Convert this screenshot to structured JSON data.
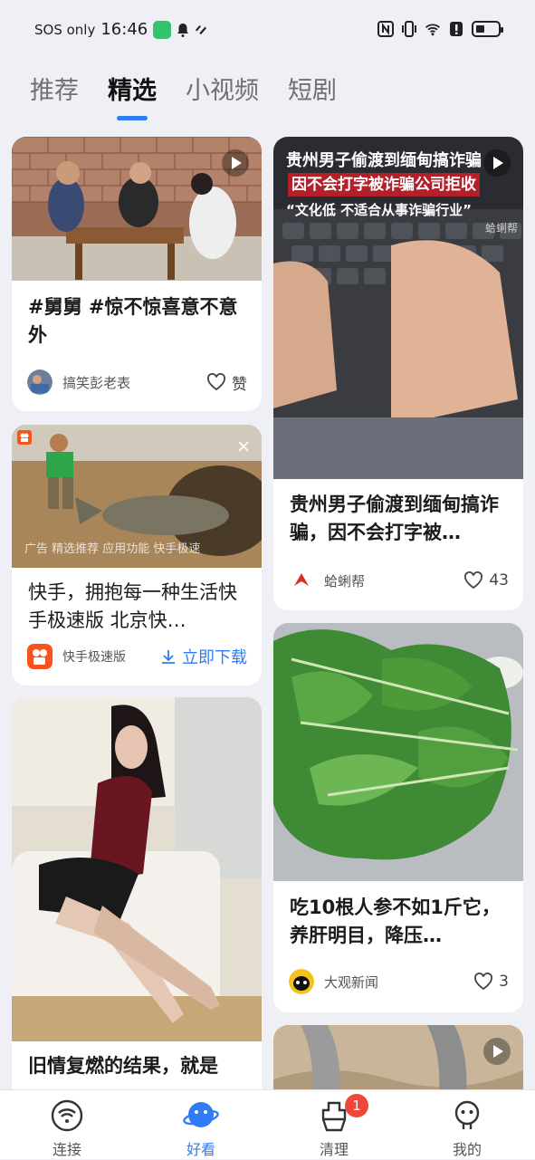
{
  "status_bar": {
    "carrier": "SOS only",
    "time": "16:46"
  },
  "tabs": [
    "推荐",
    "精选",
    "小视频",
    "短剧"
  ],
  "active_tab": "精选",
  "feed": {
    "left": [
      {
        "title": "#舅舅 #惊不惊喜意不意外",
        "author": "搞笑彭老表",
        "action": "赞"
      },
      {
        "title": "快手，拥抱每一种生活快手极速版 北京快…",
        "author": "快手极速版",
        "action": "立即下载",
        "overlay_text": "广告 精选推荐 应用功能 快手极速"
      },
      {
        "title": "旧情复燃的结果，就是"
      }
    ],
    "right": [
      {
        "title": "贵州男子偷渡到缅甸搞诈骗，因不会打字被…",
        "author": "蛤蜊帮",
        "likes": "43",
        "overlay": {
          "line1": "贵州男子偷渡到缅甸搞诈骗",
          "line2": "因不会打字被诈骗公司拒收",
          "line3": "“文化低 不适合从事诈骗行业”",
          "watermark": "蛤蜊帮"
        }
      },
      {
        "title": "吃10根人参不如1斤它，养肝明目，降压…",
        "author": "大观新闻",
        "likes": "3"
      }
    ]
  },
  "bottom_nav": [
    {
      "label": "连接",
      "icon": "wifi-icon"
    },
    {
      "label": "好看",
      "icon": "planet-icon"
    },
    {
      "label": "清理",
      "icon": "broom-icon",
      "badge": "1"
    },
    {
      "label": "我的",
      "icon": "profile-icon"
    }
  ],
  "colors": {
    "accent": "#2f7cf6",
    "badge": "#f0463c",
    "background": "#eef0f5"
  }
}
